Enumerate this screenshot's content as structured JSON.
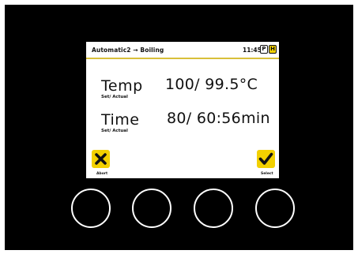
{
  "header": {
    "breadcrumb": "Automatic2 → Boiling",
    "time": "11:45",
    "indicator_p": "P",
    "indicator_h": "H"
  },
  "temperature": {
    "label": "Temp",
    "sublabel": "Set/ Actual",
    "value": "100/ 99.5°C"
  },
  "duration": {
    "label": "Time",
    "sublabel": "Set/ Actual",
    "value": "80/ 60:56min"
  },
  "softkeys": {
    "abort_label": "Abort",
    "select_label": "Select",
    "abort_icon": "close-icon",
    "select_icon": "checkmark-icon"
  },
  "colors": {
    "accent": "#f2d000",
    "divider": "#d8bf3a",
    "bezel": "#000000",
    "screen": "#ffffff"
  }
}
